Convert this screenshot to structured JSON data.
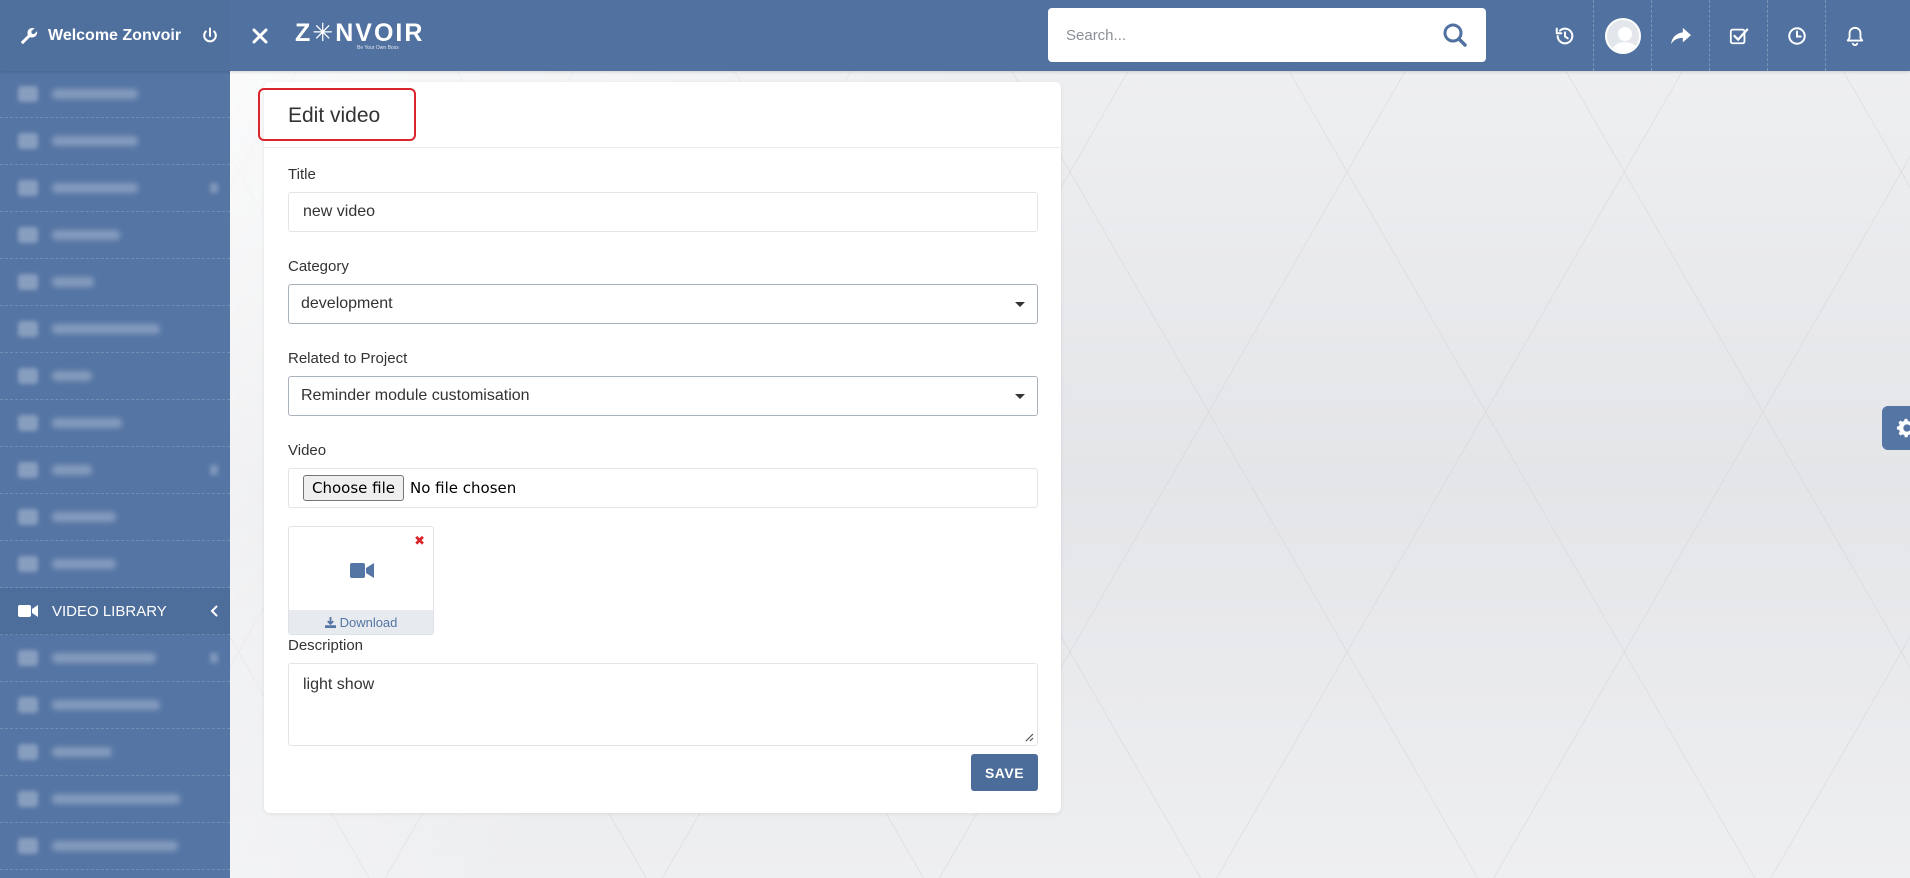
{
  "topbar": {
    "welcome": "Welcome Zonvoir",
    "logo": "Z✳NVOIR",
    "logo_tagline": "Be Your Own Boss",
    "search_placeholder": "Search..."
  },
  "sidebar": {
    "active_item": "VIDEO LIBRARY",
    "blurred_items_above": 11,
    "blurred_items_below": 5
  },
  "form": {
    "heading": "Edit video",
    "title_label": "Title",
    "title_value": "new video",
    "category_label": "Category",
    "category_value": "development",
    "project_label": "Related to Project",
    "project_value": "Reminder module customisation",
    "video_label": "Video",
    "file_button": "Choose file",
    "file_status": "No file chosen",
    "remove_symbol": "✖",
    "download_label": "Download",
    "description_label": "Description",
    "description_value": "light show",
    "save_label": "SAVE"
  },
  "colors": {
    "primary": "#5172a0",
    "sidebar": "#5575a4",
    "highlight": "#d9262d",
    "save": "#4c6c9a"
  }
}
